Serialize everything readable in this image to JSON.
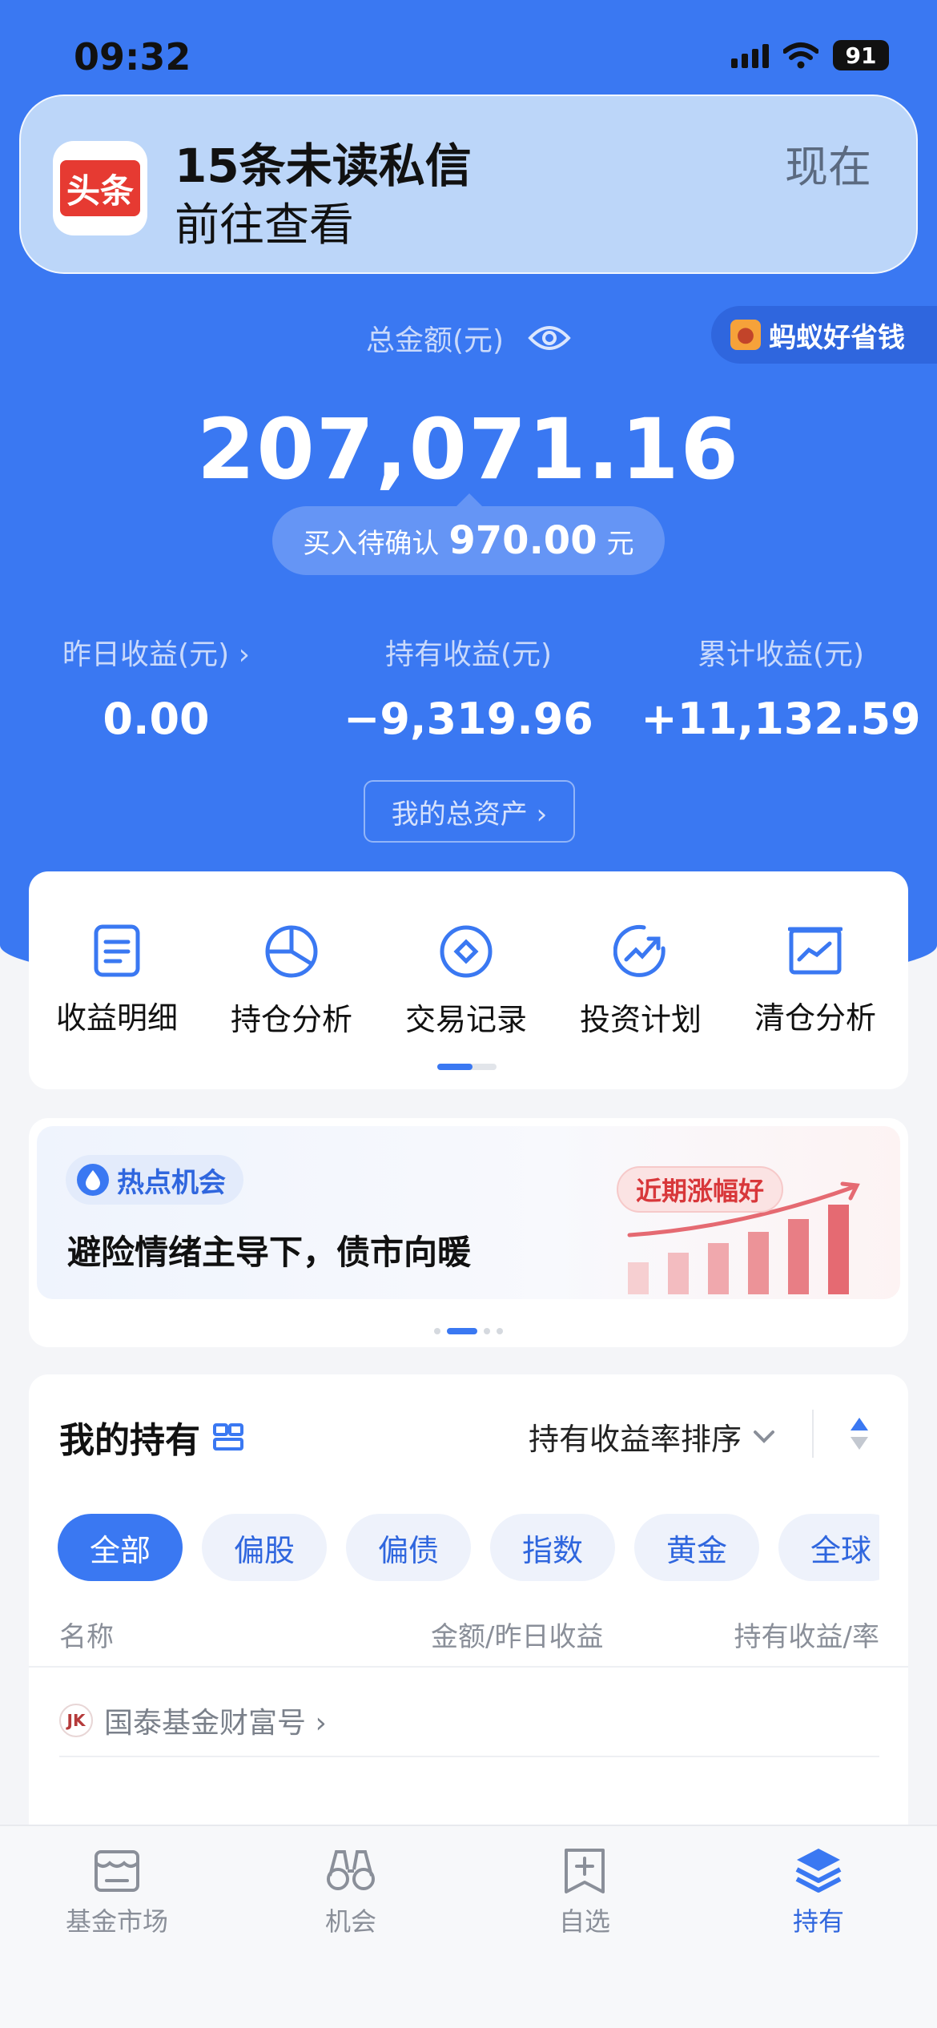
{
  "status_bar": {
    "time": "09:32",
    "battery": "91"
  },
  "notification": {
    "app_icon_text": "头条",
    "title": "15条未读私信",
    "body": "前往查看",
    "time": "现在"
  },
  "summary": {
    "total_label": "总金额(元)",
    "promo": "蚂蚁好省钱",
    "total_amount": "207,071.16",
    "pending_label": "买入待确认",
    "pending_value": "970.00",
    "pending_unit": "元",
    "stats": [
      {
        "label": "昨日收益(元) ›",
        "value": "0.00"
      },
      {
        "label": "持有收益(元)",
        "value": "−9,319.96"
      },
      {
        "label": "累计收益(元)",
        "value": "+11,132.59"
      }
    ],
    "assets_button": "我的总资产 ›"
  },
  "tools": [
    {
      "label": "收益明细",
      "icon": "document-icon"
    },
    {
      "label": "持仓分析",
      "icon": "pie-chart-icon"
    },
    {
      "label": "交易记录",
      "icon": "record-icon"
    },
    {
      "label": "投资计划",
      "icon": "trend-up-icon"
    },
    {
      "label": "清仓分析",
      "icon": "board-chart-icon"
    }
  ],
  "hot": {
    "tag": "热点机会",
    "headline": "避险情绪主导下，债市向暖",
    "badge": "近期涨幅好"
  },
  "holdings": {
    "title": "我的持有",
    "sort_label": "持有收益率排序",
    "chips": [
      "全部",
      "偏股",
      "偏债",
      "指数",
      "黄金",
      "全球"
    ],
    "columns": {
      "name": "名称",
      "amount": "金额/昨日收益",
      "hold": "持有收益/率"
    },
    "provider": "国泰基金财富号 ›",
    "provider_logo": "JK"
  },
  "tabbar": [
    {
      "label": "基金市场",
      "icon": "market-icon"
    },
    {
      "label": "机会",
      "icon": "binoculars-icon"
    },
    {
      "label": "自选",
      "icon": "bookmark-add-icon"
    },
    {
      "label": "持有",
      "icon": "layers-icon"
    }
  ],
  "colors": {
    "accent": "#3a78f2",
    "brand_red": "#e63a32",
    "text": "#111111"
  }
}
